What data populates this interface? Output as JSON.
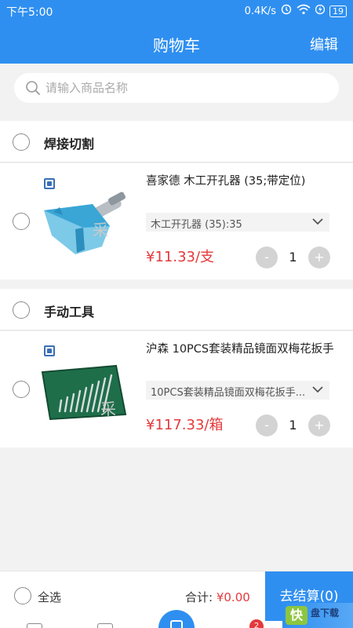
{
  "status_bar": {
    "time": "下午5:00",
    "speed": "0.4K/s",
    "battery": "19"
  },
  "nav": {
    "title": "购物车",
    "edit_label": "编辑"
  },
  "search": {
    "placeholder": "请输入商品名称"
  },
  "groups": [
    {
      "name": "焊接切割",
      "items": [
        {
          "name": "喜家德 木工开孔器 (35;带定位)",
          "spec": "木工开孔器 (35):35",
          "price": "¥11.33/支",
          "qty": "1"
        }
      ]
    },
    {
      "name": "手动工具",
      "items": [
        {
          "name": "沪森 10PCS套装精品镜面双梅花扳手",
          "spec": "10PCS套装精品镜面双梅花扳手...",
          "price": "¥117.33/箱",
          "qty": "1"
        }
      ]
    }
  ],
  "footer": {
    "select_all": "全选",
    "total_label": "合计:",
    "total_amount": "¥0.00",
    "checkout_label": "去结算(0)"
  },
  "tabbar": {
    "cart_badge": "2"
  },
  "watermark": {
    "char": "快",
    "text": "盘下载"
  },
  "colors": {
    "primary": "#2f8ff0",
    "price": "#e4393c"
  }
}
